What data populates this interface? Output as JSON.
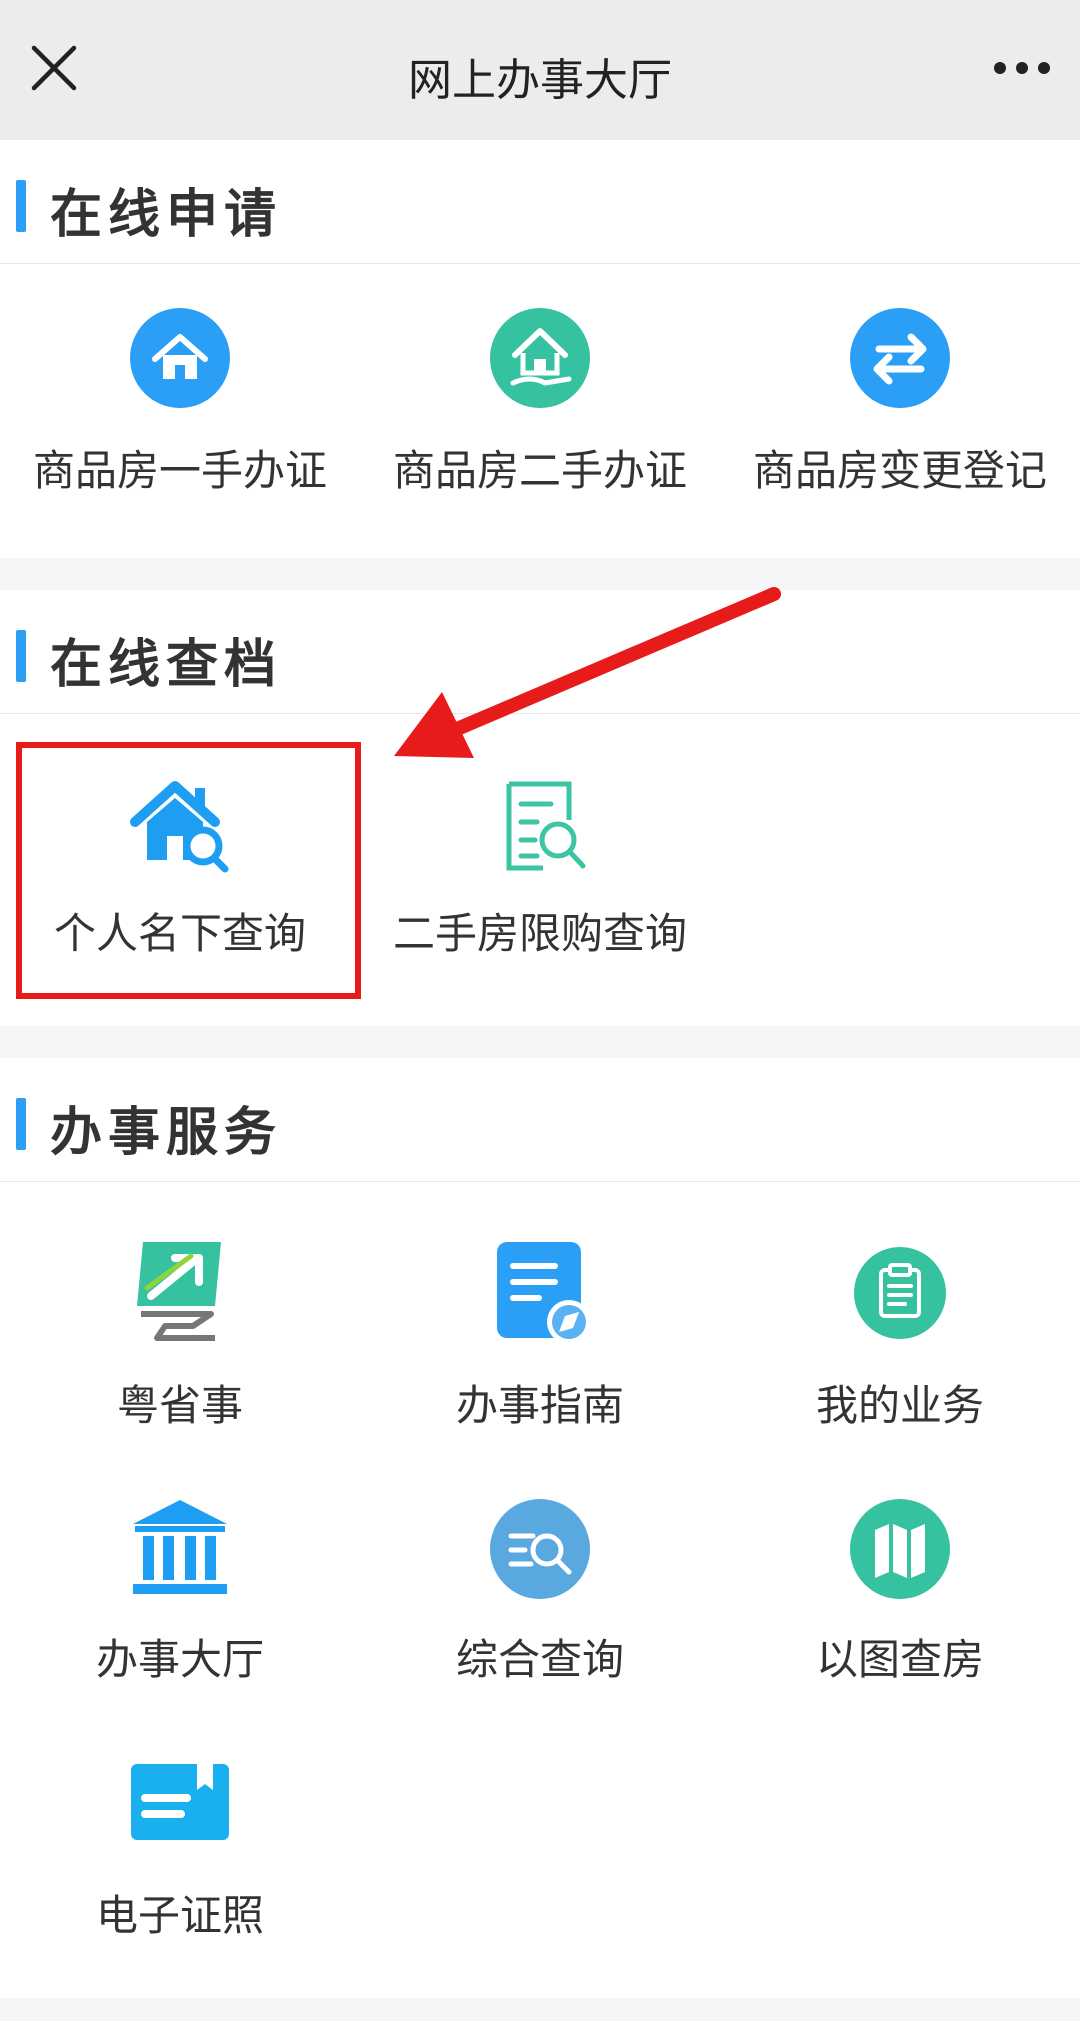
{
  "header": {
    "title": "网上办事大厅",
    "close_icon": "close-icon",
    "more_icon": "more-icon"
  },
  "sections": [
    {
      "title": "在线申请",
      "items": [
        {
          "label": "商品房一手办证",
          "icon": "home-circle-icon",
          "color": "#2b9ff5"
        },
        {
          "label": "商品房二手办证",
          "icon": "home-hand-icon",
          "color": "#36c2a1"
        },
        {
          "label": "商品房变更登记",
          "icon": "exchange-arrows-icon",
          "color": "#2b9ff5"
        }
      ]
    },
    {
      "title": "在线查档",
      "items": [
        {
          "label": "个人名下查询",
          "icon": "house-search-icon",
          "color": "#1e9ef2"
        },
        {
          "label": "二手房限购查询",
          "icon": "document-search-icon",
          "color": "#3cc4a5"
        }
      ]
    },
    {
      "title": "办事服务",
      "items": [
        {
          "label": "粤省事",
          "icon": "yueshengshi-logo-icon"
        },
        {
          "label": "办事指南",
          "icon": "guide-document-icon",
          "color": "#2b9ff5"
        },
        {
          "label": "我的业务",
          "icon": "clipboard-icon",
          "color": "#36c2a1"
        },
        {
          "label": "办事大厅",
          "icon": "bank-building-icon",
          "color": "#1e9ef2"
        },
        {
          "label": "综合查询",
          "icon": "search-list-icon",
          "color": "#5aa8e0"
        },
        {
          "label": "以图查房",
          "icon": "map-icon",
          "color": "#36c2a1"
        },
        {
          "label": "电子证照",
          "icon": "certificate-icon",
          "color": "#1ab0f0"
        }
      ]
    }
  ],
  "annotation": {
    "highlight_color": "#e81b1b"
  }
}
